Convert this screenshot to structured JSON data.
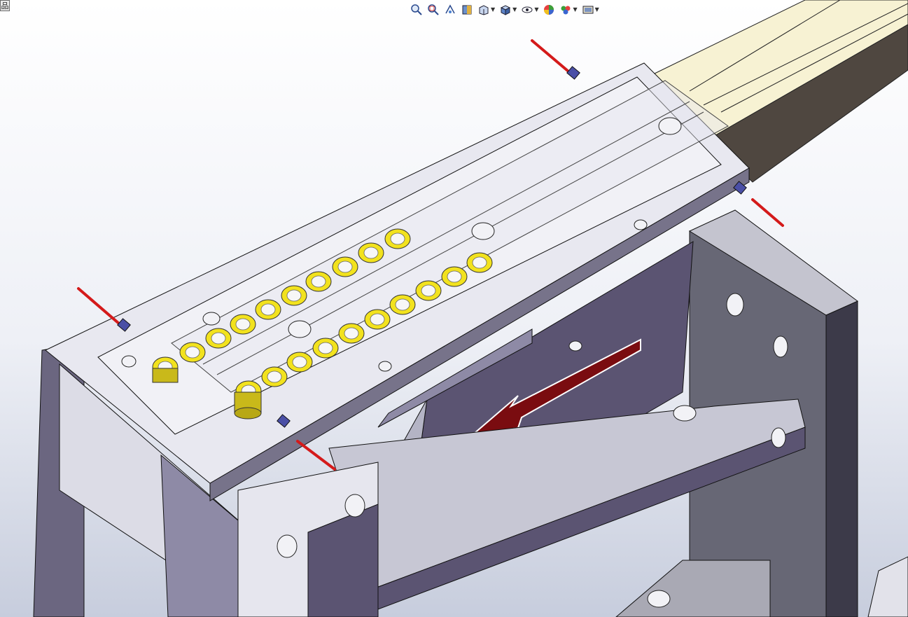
{
  "corner_button": {
    "label": "品"
  },
  "heads_up_toolbar": {
    "items": [
      {
        "icon": "zoom-to-fit-icon",
        "has_dropdown": false
      },
      {
        "icon": "zoom-to-area-icon",
        "has_dropdown": false
      },
      {
        "icon": "previous-view-icon",
        "has_dropdown": false
      },
      {
        "icon": "section-view-icon",
        "has_dropdown": false
      },
      {
        "icon": "view-orientation-icon",
        "has_dropdown": true
      },
      {
        "icon": "display-style-icon",
        "has_dropdown": true
      },
      {
        "icon": "hide-show-items-icon",
        "has_dropdown": true
      },
      {
        "icon": "edit-appearance-icon",
        "has_dropdown": false
      },
      {
        "icon": "apply-scene-icon",
        "has_dropdown": true
      },
      {
        "icon": "view-settings-icon",
        "has_dropdown": true
      }
    ]
  },
  "colors": {
    "background_top": "#ffffff",
    "background_bottom": "#c9cfe0",
    "metal_top": "#e4e4ee",
    "metal_side": "#5a546b",
    "bearing_yellow": "#f2e21e",
    "sensor_red": "#d41a1a",
    "arrow_red": "#7a0c10",
    "rail_cream": "#f6f0cc"
  }
}
